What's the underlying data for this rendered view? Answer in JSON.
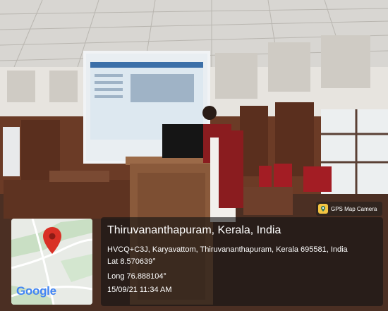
{
  "location": {
    "title": "Thiruvananthapuram, Kerala, India",
    "address": "HVCQ+C3J, Karyavattom, Thiruvananthapuram, Kerala 695581, India",
    "lat": "Lat 8.570639°",
    "long": "Long 76.888104°",
    "datetime": "15/09/21 11:34 AM"
  },
  "badge": {
    "label": "GPS Map Camera",
    "icon": "map-pin-icon"
  },
  "map": {
    "logo_text": "Google",
    "pin_color": "#d93025"
  },
  "colors": {
    "overlay": "#141414",
    "wood": "#6b3b26",
    "screen": "#e9eef2"
  }
}
